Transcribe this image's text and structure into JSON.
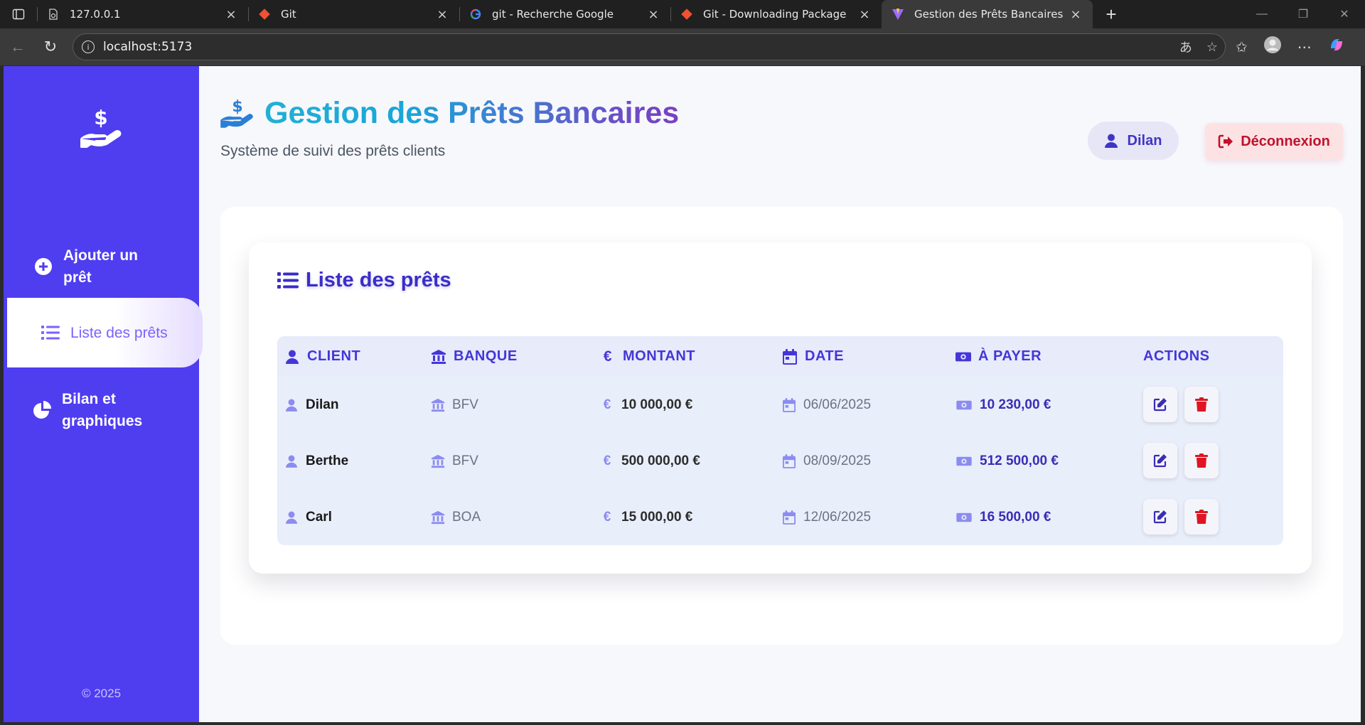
{
  "browser": {
    "tabs": [
      {
        "title": "127.0.0.1"
      },
      {
        "title": "Git"
      },
      {
        "title": "git - Recherche Google"
      },
      {
        "title": "Git - Downloading Package"
      },
      {
        "title": "Gestion des Prêts Bancaires"
      }
    ],
    "url": "localhost:5173"
  },
  "sidebar": {
    "items": [
      {
        "label": "Ajouter un prêt"
      },
      {
        "label": "Liste des prêts"
      },
      {
        "label": "Bilan et graphiques"
      }
    ],
    "copyright": "© 2025"
  },
  "header": {
    "title": "Gestion des Prêts Bancaires",
    "subtitle": "Système de suivi des prêts clients",
    "user_name": "Dilan",
    "logout_label": "Déconnexion"
  },
  "loans": {
    "title": "Liste des prêts",
    "columns": [
      "CLIENT",
      "BANQUE",
      "MONTANT",
      "DATE",
      "À PAYER",
      "ACTIONS"
    ],
    "rows": [
      {
        "client": "Dilan",
        "bank": "BFV",
        "amount": "10 000,00 €",
        "date": "06/06/2025",
        "to_pay": "10 230,00 €"
      },
      {
        "client": "Berthe",
        "bank": "BFV",
        "amount": "500 000,00 €",
        "date": "08/09/2025",
        "to_pay": "512 500,00 €"
      },
      {
        "client": "Carl",
        "bank": "BOA",
        "amount": "15 000,00 €",
        "date": "12/06/2025",
        "to_pay": "16 500,00 €"
      }
    ]
  },
  "colors": {
    "sidebar": "#4f3df0",
    "accent": "#4636d8",
    "danger": "#c0122c"
  }
}
